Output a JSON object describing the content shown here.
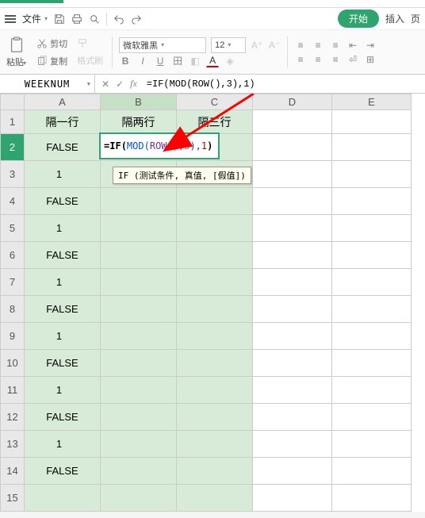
{
  "menu": {
    "file": "文件",
    "start_btn": "开始",
    "insert": "插入"
  },
  "ribbon": {
    "paste": "粘贴",
    "cut": "剪切",
    "copy": "复制",
    "format_painter": "格式刷",
    "font_name": "微软雅黑",
    "font_size": "12"
  },
  "formula_bar": {
    "name_box": "WEEKNUM",
    "formula": "=IF(MOD(ROW(),3),1)"
  },
  "columns": [
    "A",
    "B",
    "C",
    "D",
    "E"
  ],
  "rows": [
    1,
    2,
    3,
    4,
    5,
    6,
    7,
    8,
    9,
    10,
    11,
    12,
    13,
    14,
    15
  ],
  "headers": {
    "A": "隔一行",
    "B": "隔两行",
    "C": "隔三行"
  },
  "data_A": {
    "2": "FALSE",
    "3": "1",
    "4": "FALSE",
    "5": "1",
    "6": "FALSE",
    "7": "1",
    "8": "FALSE",
    "9": "1",
    "10": "FALSE",
    "11": "1",
    "12": "FALSE",
    "13": "1",
    "14": "FALSE"
  },
  "active_cell": {
    "parts": [
      "=",
      "IF",
      "(",
      "MOD",
      "(",
      "ROW",
      "(),",
      "3",
      "),",
      "1",
      ")"
    ]
  },
  "tooltip": "IF (测试条件, 真值, [假值])"
}
